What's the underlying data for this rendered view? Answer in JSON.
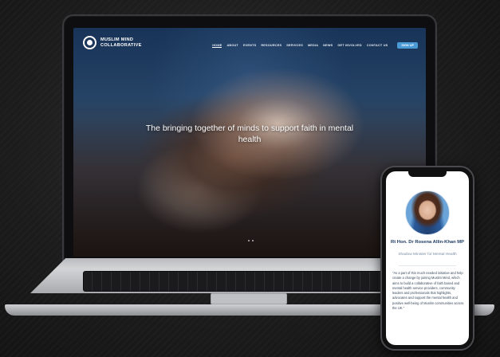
{
  "site": {
    "logo_line1": "MUSLIM MIND",
    "logo_line2": "COLLABORATIVE",
    "nav": [
      "HOME",
      "ABOUT",
      "EVENTS",
      "RESOURCES",
      "SERVICES",
      "MEDIA",
      "NEWS",
      "GET INVOLVED",
      "CONTACT US"
    ],
    "login_label": "SIGN UP",
    "hero_title": "The bringing together of minds to support faith in mental health",
    "accent_color": "#4a9ad6"
  },
  "phone": {
    "name": "Rt Hon. Dr Rosena Allin-Khan MP",
    "role": "Shadow Minister for Mental Health",
    "quote": "\"As a part of this much needed initiative and help create a change by joining Muslim Mind, which aims to build a collaborative of faith based and mental health service providers, community leaders and professionals that highlights, advocates and support the mental health and positive well-being of Muslim communities across the UK.\""
  }
}
